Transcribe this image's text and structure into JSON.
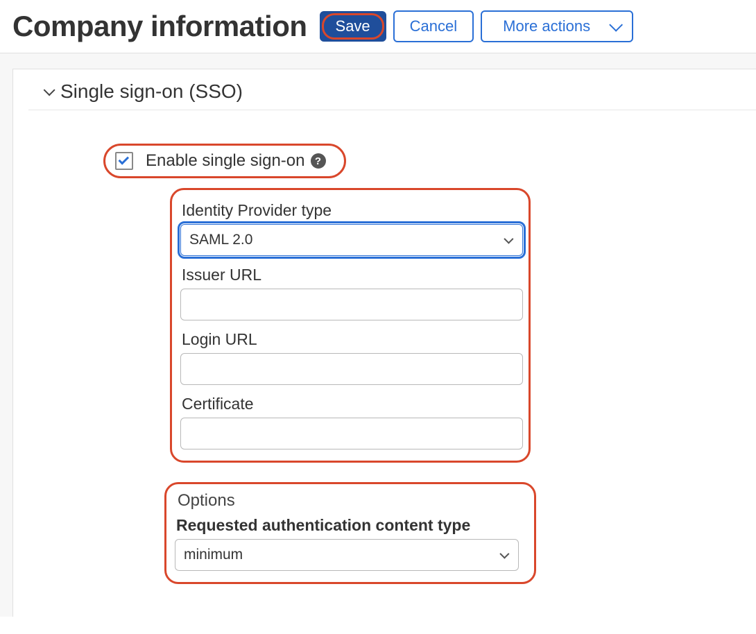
{
  "header": {
    "title": "Company information",
    "save_label": "Save",
    "cancel_label": "Cancel",
    "more_actions_label": "More actions"
  },
  "section": {
    "title": "Single sign-on (SSO)"
  },
  "sso": {
    "enable_label": "Enable single sign-on",
    "enabled": true,
    "idp_type_label": "Identity Provider type",
    "idp_type_value": "SAML 2.0",
    "issuer_url_label": "Issuer URL",
    "issuer_url_value": "",
    "login_url_label": "Login URL",
    "login_url_value": "",
    "certificate_label": "Certificate",
    "certificate_value": ""
  },
  "options": {
    "title": "Options",
    "auth_content_label": "Requested authentication content type",
    "auth_content_value": "minimum"
  }
}
